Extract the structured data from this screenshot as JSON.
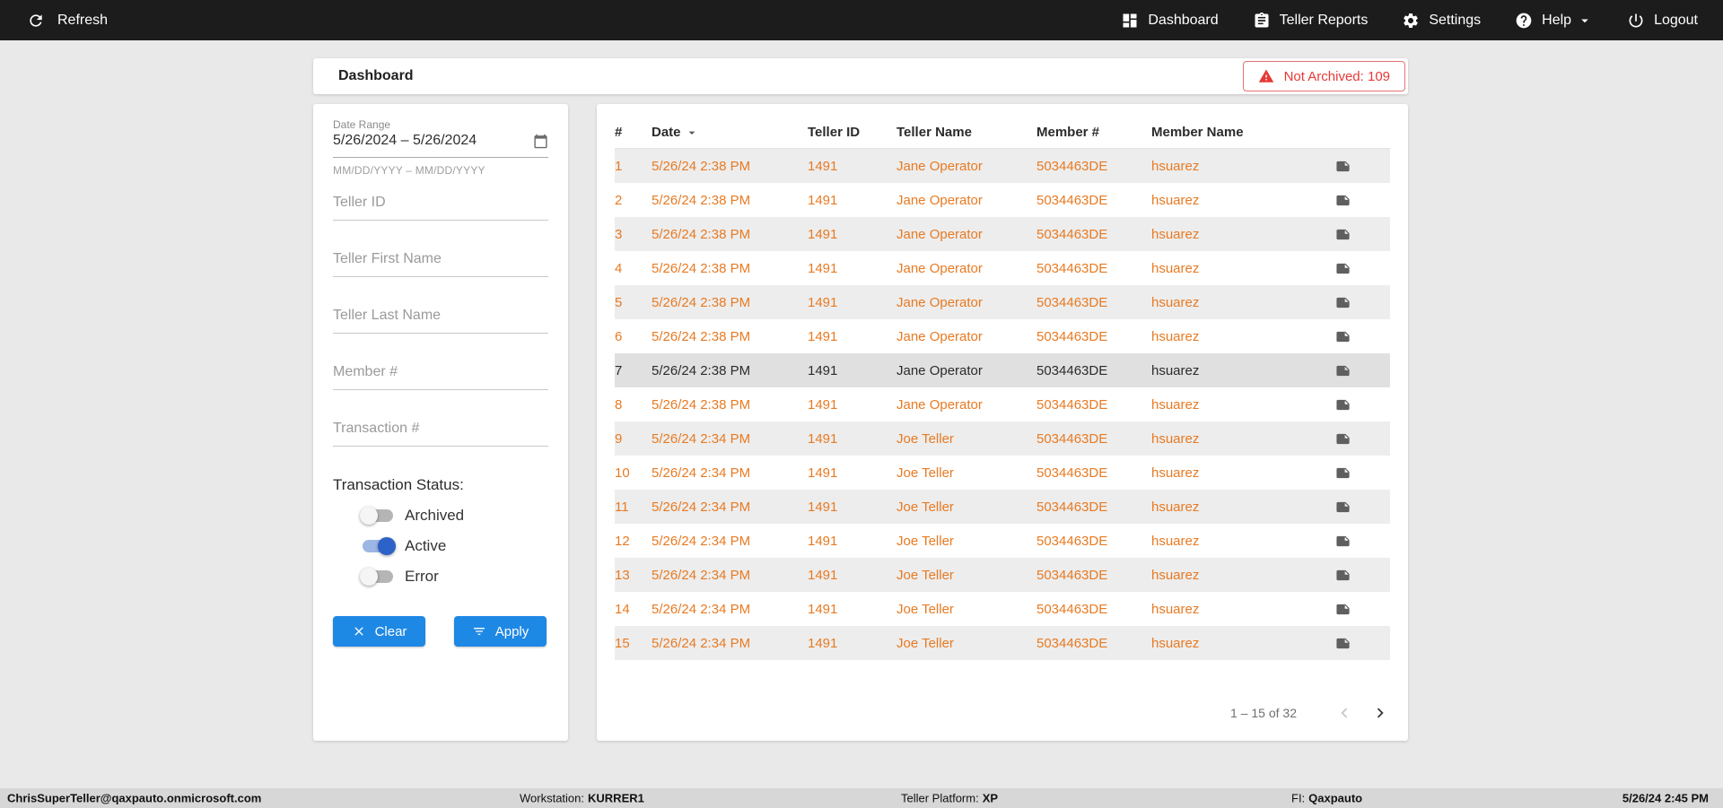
{
  "topbar": {
    "refresh_label": "Refresh",
    "nav": [
      {
        "id": "dashboard",
        "label": "Dashboard",
        "icon": "dashboard-icon",
        "has_dropdown": false
      },
      {
        "id": "teller-reports",
        "label": "Teller Reports",
        "icon": "teller-reports-icon",
        "has_dropdown": false
      },
      {
        "id": "settings",
        "label": "Settings",
        "icon": "settings-icon",
        "has_dropdown": false
      },
      {
        "id": "help",
        "label": "Help",
        "icon": "help-icon",
        "has_dropdown": true
      },
      {
        "id": "logout",
        "label": "Logout",
        "icon": "logout-icon",
        "has_dropdown": false
      }
    ]
  },
  "header": {
    "title": "Dashboard",
    "badge": {
      "icon": "warning-icon",
      "text": "Not Archived: 109",
      "color": "#e53935"
    }
  },
  "filters": {
    "date_range": {
      "label": "Date Range",
      "value": "5/26/2024 – 5/26/2024",
      "helper": "MM/DD/YYYY – MM/DD/YYYY",
      "icon": "calendar-icon"
    },
    "inputs": [
      {
        "id": "teller-id",
        "placeholder": "Teller ID",
        "value": ""
      },
      {
        "id": "teller-first-name",
        "placeholder": "Teller First Name",
        "value": ""
      },
      {
        "id": "teller-last-name",
        "placeholder": "Teller Last Name",
        "value": ""
      },
      {
        "id": "member-number",
        "placeholder": "Member #",
        "value": ""
      },
      {
        "id": "transaction-number",
        "placeholder": "Transaction #",
        "value": ""
      }
    ],
    "status_label": "Transaction Status:",
    "toggles": [
      {
        "id": "archived",
        "label": "Archived",
        "on": false
      },
      {
        "id": "active",
        "label": "Active",
        "on": true
      },
      {
        "id": "error",
        "label": "Error",
        "on": false
      }
    ],
    "clear_label": "Clear",
    "apply_label": "Apply",
    "accent_color": "#1e88e5",
    "toggle_on_color": "#2d62c9"
  },
  "table": {
    "columns": [
      "#",
      "Date",
      "Teller ID",
      "Teller Name",
      "Member #",
      "Member Name"
    ],
    "sorted_column": "Date",
    "row_text_color": "#e87a22",
    "rows": [
      {
        "num": "1",
        "date": "5/26/24 2:38 PM",
        "teller_id": "1491",
        "teller_name": "Jane Operator",
        "member_number": "5034463DE",
        "member_name": "hsuarez",
        "selected": false
      },
      {
        "num": "2",
        "date": "5/26/24 2:38 PM",
        "teller_id": "1491",
        "teller_name": "Jane Operator",
        "member_number": "5034463DE",
        "member_name": "hsuarez",
        "selected": false
      },
      {
        "num": "3",
        "date": "5/26/24 2:38 PM",
        "teller_id": "1491",
        "teller_name": "Jane Operator",
        "member_number": "5034463DE",
        "member_name": "hsuarez",
        "selected": false
      },
      {
        "num": "4",
        "date": "5/26/24 2:38 PM",
        "teller_id": "1491",
        "teller_name": "Jane Operator",
        "member_number": "5034463DE",
        "member_name": "hsuarez",
        "selected": false
      },
      {
        "num": "5",
        "date": "5/26/24 2:38 PM",
        "teller_id": "1491",
        "teller_name": "Jane Operator",
        "member_number": "5034463DE",
        "member_name": "hsuarez",
        "selected": false
      },
      {
        "num": "6",
        "date": "5/26/24 2:38 PM",
        "teller_id": "1491",
        "teller_name": "Jane Operator",
        "member_number": "5034463DE",
        "member_name": "hsuarez",
        "selected": false
      },
      {
        "num": "7",
        "date": "5/26/24 2:38 PM",
        "teller_id": "1491",
        "teller_name": "Jane Operator",
        "member_number": "5034463DE",
        "member_name": "hsuarez",
        "selected": true
      },
      {
        "num": "8",
        "date": "5/26/24 2:38 PM",
        "teller_id": "1491",
        "teller_name": "Jane Operator",
        "member_number": "5034463DE",
        "member_name": "hsuarez",
        "selected": false
      },
      {
        "num": "9",
        "date": "5/26/24 2:34 PM",
        "teller_id": "1491",
        "teller_name": "Joe Teller",
        "member_number": "5034463DE",
        "member_name": "hsuarez",
        "selected": false
      },
      {
        "num": "10",
        "date": "5/26/24 2:34 PM",
        "teller_id": "1491",
        "teller_name": "Joe Teller",
        "member_number": "5034463DE",
        "member_name": "hsuarez",
        "selected": false
      },
      {
        "num": "11",
        "date": "5/26/24 2:34 PM",
        "teller_id": "1491",
        "teller_name": "Joe Teller",
        "member_number": "5034463DE",
        "member_name": "hsuarez",
        "selected": false
      },
      {
        "num": "12",
        "date": "5/26/24 2:34 PM",
        "teller_id": "1491",
        "teller_name": "Joe Teller",
        "member_number": "5034463DE",
        "member_name": "hsuarez",
        "selected": false
      },
      {
        "num": "13",
        "date": "5/26/24 2:34 PM",
        "teller_id": "1491",
        "teller_name": "Joe Teller",
        "member_number": "5034463DE",
        "member_name": "hsuarez",
        "selected": false
      },
      {
        "num": "14",
        "date": "5/26/24 2:34 PM",
        "teller_id": "1491",
        "teller_name": "Joe Teller",
        "member_number": "5034463DE",
        "member_name": "hsuarez",
        "selected": false
      },
      {
        "num": "15",
        "date": "5/26/24 2:34 PM",
        "teller_id": "1491",
        "teller_name": "Joe Teller",
        "member_number": "5034463DE",
        "member_name": "hsuarez",
        "selected": false
      }
    ],
    "row_action_icon": "note-icon",
    "pagination": {
      "range_label": "1 – 15 of 32"
    }
  },
  "statusbar": {
    "user": "ChrisSuperTeller@qaxpauto.onmicrosoft.com",
    "workstation_label": "Workstation:",
    "workstation_value": "KURRER1",
    "platform_label": "Teller Platform:",
    "platform_value": "XP",
    "fi_label": "FI:",
    "fi_value": "Qaxpauto",
    "datetime": "5/26/24 2:45 PM"
  }
}
